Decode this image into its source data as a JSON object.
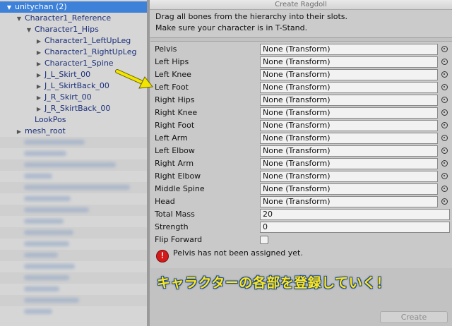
{
  "hierarchy": {
    "items": [
      {
        "label": "unitychan (2)",
        "indent": 1,
        "arrow": "▼",
        "selected": true
      },
      {
        "label": "Character1_Reference",
        "indent": 2,
        "arrow": "▼"
      },
      {
        "label": "Character1_Hips",
        "indent": 3,
        "arrow": "▼"
      },
      {
        "label": "Character1_LeftUpLeg",
        "indent": 4,
        "arrow": "▶"
      },
      {
        "label": "Character1_RightUpLeg",
        "indent": 4,
        "arrow": "▶"
      },
      {
        "label": "Character1_Spine",
        "indent": 4,
        "arrow": "▶"
      },
      {
        "label": "J_L_Skirt_00",
        "indent": 4,
        "arrow": "▶"
      },
      {
        "label": "J_L_SkirtBack_00",
        "indent": 4,
        "arrow": "▶"
      },
      {
        "label": "J_R_Skirt_00",
        "indent": 4,
        "arrow": "▶"
      },
      {
        "label": "J_R_SkirtBack_00",
        "indent": 4,
        "arrow": "▶"
      },
      {
        "label": "LookPos",
        "indent": 3,
        "arrow": ""
      },
      {
        "label": "mesh_root",
        "indent": 2,
        "arrow": "▶"
      }
    ]
  },
  "window": {
    "title": "Create Ragdoll",
    "help_line1": "Drag all bones from the hierarchy into their slots.",
    "help_line2": "Make sure your character is in T-Stand."
  },
  "fields": [
    {
      "label": "Pelvis",
      "value": "None (Transform)"
    },
    {
      "label": "Left Hips",
      "value": "None (Transform)"
    },
    {
      "label": "Left Knee",
      "value": "None (Transform)"
    },
    {
      "label": "Left Foot",
      "value": "None (Transform)"
    },
    {
      "label": "Right Hips",
      "value": "None (Transform)"
    },
    {
      "label": "Right Knee",
      "value": "None (Transform)"
    },
    {
      "label": "Right Foot",
      "value": "None (Transform)"
    },
    {
      "label": "Left Arm",
      "value": "None (Transform)"
    },
    {
      "label": "Left Elbow",
      "value": "None (Transform)"
    },
    {
      "label": "Right Arm",
      "value": "None (Transform)"
    },
    {
      "label": "Right Elbow",
      "value": "None (Transform)"
    },
    {
      "label": "Middle Spine",
      "value": "None (Transform)"
    },
    {
      "label": "Head",
      "value": "None (Transform)"
    }
  ],
  "total_mass": {
    "label": "Total Mass",
    "value": "20"
  },
  "strength": {
    "label": "Strength",
    "value": "0"
  },
  "flip_forward": {
    "label": "Flip Forward",
    "checked": false
  },
  "warning": {
    "icon": "error-icon",
    "text": "Pelvis has not been assigned yet."
  },
  "caption": "キャラクターの各部を登録していく！",
  "create_button": "Create",
  "colors": {
    "selection": "#3d81d8",
    "caption_fill": "#ffe71a",
    "caption_outline": "#1f4a8a",
    "arrow": "#f2e600"
  }
}
